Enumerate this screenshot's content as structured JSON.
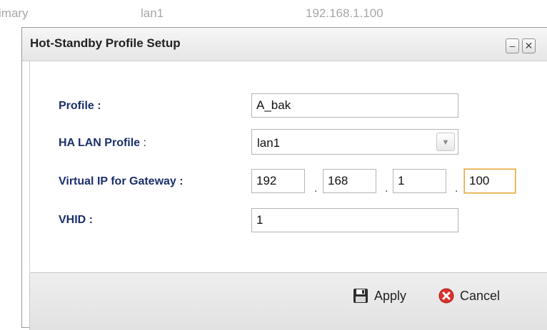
{
  "background_row": {
    "col1": "imary",
    "col2": "lan1",
    "col3": "192.168.1.100"
  },
  "dialog": {
    "title": "Hot-Standby Profile Setup",
    "minimize_label": "–",
    "close_label": "✕",
    "fields": {
      "profile_label": "Profile :",
      "profile_value": "A_bak",
      "ha_lan_label": "HA LAN Profile",
      "ha_lan_colon": " :",
      "ha_lan_value": "lan1",
      "vip_label": "Virtual IP for Gateway :",
      "vip": [
        "192",
        "168",
        "1",
        "100"
      ],
      "dot": ".",
      "vhid_label": "VHID :",
      "vhid_value": "1"
    },
    "footer": {
      "apply": "Apply",
      "cancel": "Cancel"
    }
  },
  "icons": {
    "apply": "save-icon",
    "cancel": "cancel-icon",
    "dropdown": "chevron-down-icon"
  },
  "colors": {
    "label": "#1b2f6b",
    "focus_border": "#e3a640",
    "cancel_red": "#d9322b"
  }
}
